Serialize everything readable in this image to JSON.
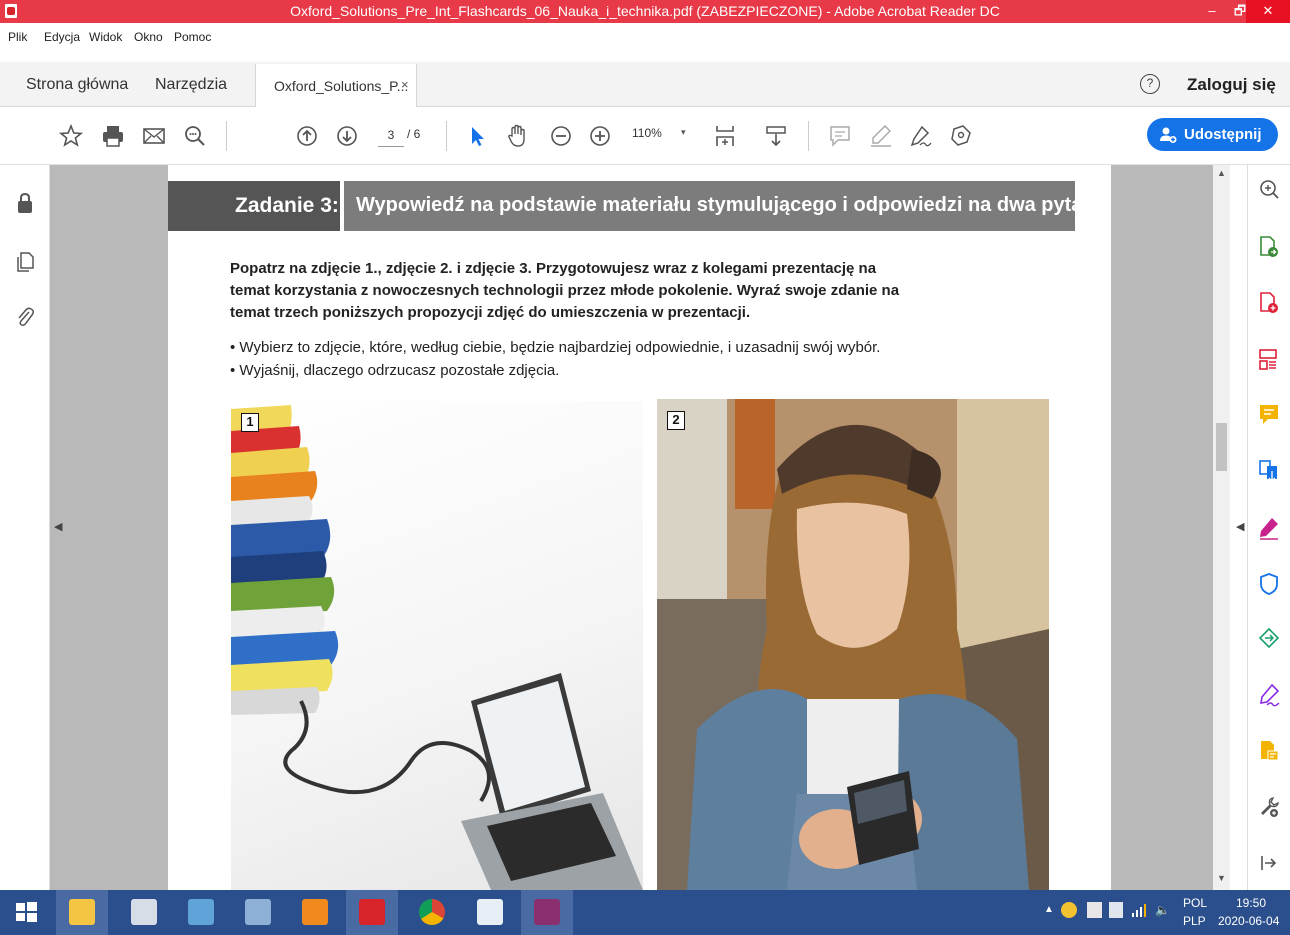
{
  "window": {
    "title": "Oxford_Solutions_Pre_Int_Flashcards_06_Nauka_i_technika.pdf (ZABEZPIECZONE) - Adobe Acrobat Reader DC",
    "minimize": "–",
    "maximize": "🗗",
    "close": "✕"
  },
  "menu": [
    "Plik",
    "Edycja",
    "Widok",
    "Okno",
    "Pomoc"
  ],
  "tabs": {
    "home": "Strona główna",
    "tools": "Narzędzia",
    "document": "Oxford_Solutions_P...",
    "close_glyph": "×",
    "help_glyph": "?",
    "login": "Zaloguj się"
  },
  "toolbar": {
    "page_current": "3",
    "page_total": "/ 6",
    "zoom": "110%",
    "zoom_caret": "▾",
    "share_label": "Udostępnij"
  },
  "document": {
    "task_label": "Zadanie 3:",
    "task_title": "Wypowiedź na podstawie materiału stymulującego i odpowiedzi na dwa pytania",
    "paragraph": "Popatrz na zdjęcie 1., zdjęcie 2. i zdjęcie 3. Przygotowujesz wraz z kolegami prezentację na temat korzystania z nowoczesnych technologii przez młode pokolenie. Wyraź swoje zdanie na temat trzech poniższych propozycji zdjęć do umieszczenia w prezentacji.",
    "bullets": [
      "Wybierz to zdjęcie, które, według ciebie, będzie najbardziej odpowiednie, i uzasadnij swój wybór.",
      "Wyjaśnij, dlaczego odrzucasz pozostałe zdjęcia."
    ],
    "photo1_number": "1",
    "photo2_number": "2"
  },
  "taskbar": {
    "lang_top": "POL",
    "lang_bottom": "PLP",
    "time": "19:50",
    "date": "2020-06-04"
  },
  "colors": {
    "titlebar": "#e73947",
    "share": "#1473e6",
    "taskbar": "#2b4f8c",
    "right_tools": [
      "#3a8a3a",
      "#e0213a",
      "#e0213a",
      "#f2b400",
      "#1473e6",
      "#c8238c",
      "#1473e6",
      "#18a06a",
      "#8a2be2",
      "#f2b400",
      "#555555"
    ]
  }
}
